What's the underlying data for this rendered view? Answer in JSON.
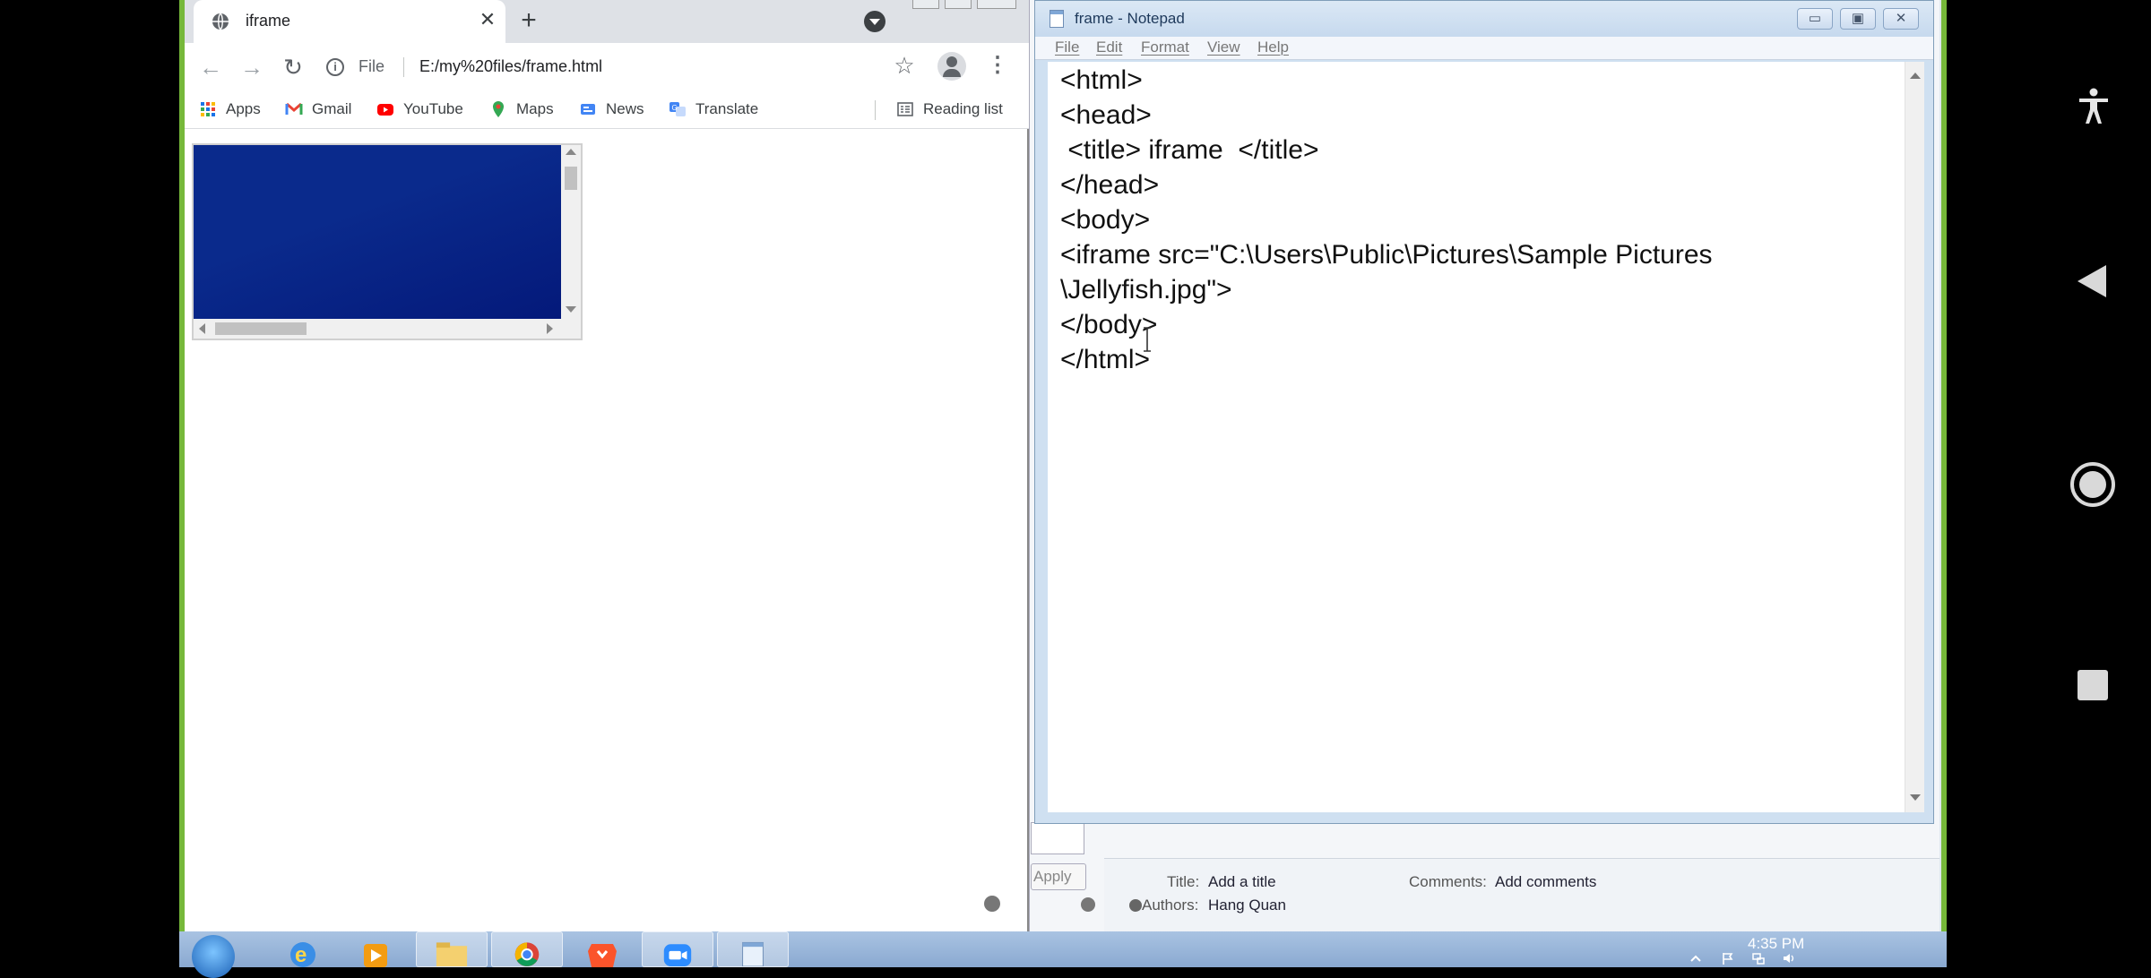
{
  "chrome": {
    "tab_title": "iframe",
    "tab_close": "✕",
    "new_tab": "+",
    "nav_back": "←",
    "nav_forward": "→",
    "nav_reload": "↻",
    "info_glyph": "i",
    "url_scheme_label": "File",
    "url": "E:/my%20files/frame.html",
    "star": "☆",
    "menu": "⋮",
    "bookmarks": [
      {
        "label": "Apps",
        "icon": "apps-grid-icon"
      },
      {
        "label": "Gmail",
        "icon": "gmail-icon"
      },
      {
        "label": "YouTube",
        "icon": "youtube-icon"
      },
      {
        "label": "Maps",
        "icon": "maps-icon"
      },
      {
        "label": "News",
        "icon": "news-icon"
      },
      {
        "label": "Translate",
        "icon": "translate-icon"
      }
    ],
    "reading_list": "Reading list"
  },
  "notepad": {
    "title": "frame - Notepad",
    "menus": [
      "File",
      "Edit",
      "Format",
      "View",
      "Help"
    ],
    "controls": {
      "minimize": "▭",
      "maximize": "▣",
      "close": "✕"
    },
    "lines": [
      "<html>",
      "<head>",
      " <title> iframe  </title>",
      "</head>",
      "<body>",
      "<iframe src=\"C:\\Users\\Public\\Pictures\\Sample Pictures",
      "\\Jellyfish.jpg\">",
      "</body>",
      "</html>"
    ]
  },
  "details_pane": {
    "apply": "Apply",
    "title_label": "Title:",
    "title_value": "Add a title",
    "comments_label": "Comments:",
    "comments_value": "Add comments",
    "authors_label": "Authors:",
    "authors_value": "Hang Quan"
  },
  "taskbar": {
    "clock_time": "4:35 PM"
  },
  "colors": {
    "iframe_image": "#0a2a8c",
    "green_border": "#76b83a",
    "taskbar": "#a9c3e2"
  }
}
